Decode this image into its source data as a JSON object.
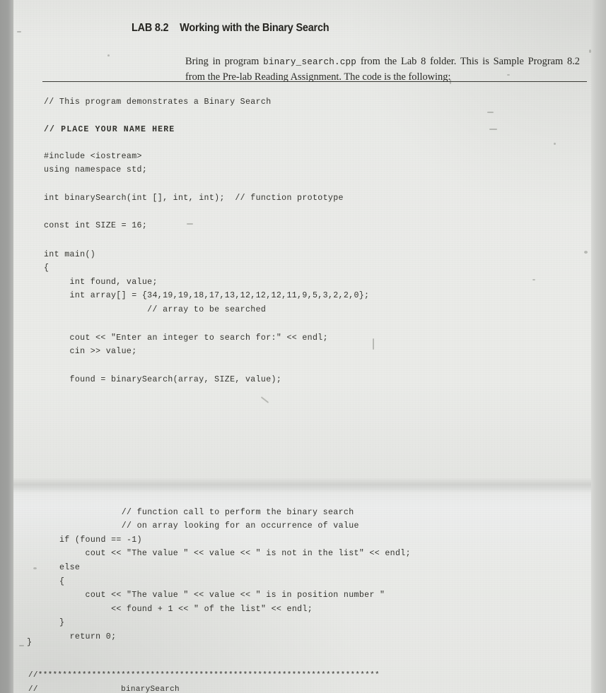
{
  "document": {
    "type": "scanned-textbook-page",
    "lab_number": "LAB 8.2",
    "lab_title": "Working with the Binary Search",
    "intro_before_mono": "Bring in program ",
    "intro_mono_filename": "binary_search.cpp",
    "intro_after_mono": " from the Lab 8 folder. This is Sample Program 8.2 from the Pre-lab Reading Assignment. The code is the following:"
  },
  "code": {
    "header_comment": "// This program demonstrates a Binary Search",
    "name_placeholder": "// PLACE YOUR NAME HERE",
    "includes": "#include <iostream>\nusing namespace std;",
    "prototype": "int binarySearch(int [], int, int);  // function prototype",
    "const_size": "const int SIZE = 16;",
    "main_open": "int main()\n{",
    "declarations": "     int found, value;\n     int array[] = {34,19,19,18,17,13,12,12,12,11,9,5,3,2,2,0};\n                    // array to be searched",
    "io_block": "     cout << \"Enter an integer to search for:\" << endl;\n     cin >> value;",
    "call_line": "     found = binarySearch(array, SIZE, value);",
    "tail_block": "            // function call to perform the binary search\n            // on array looking for an occurrence of value\nif (found == -1)\n     cout << \"The value \" << value << \" is not in the list\" << endl;\nelse\n{\n     cout << \"The value \" << value << \" is in position number \"\n          << found + 1 << \" of the list\" << endl;\n}\n  return 0;",
    "closing_brace": "}",
    "footer_banner": "//**********************************************************************\n//                 binarySearch"
  },
  "colors": {
    "paper": "#e9eae7",
    "ink": "#33332e",
    "title_ink": "#24241f",
    "scanner_edge": "#9b9c9a"
  }
}
